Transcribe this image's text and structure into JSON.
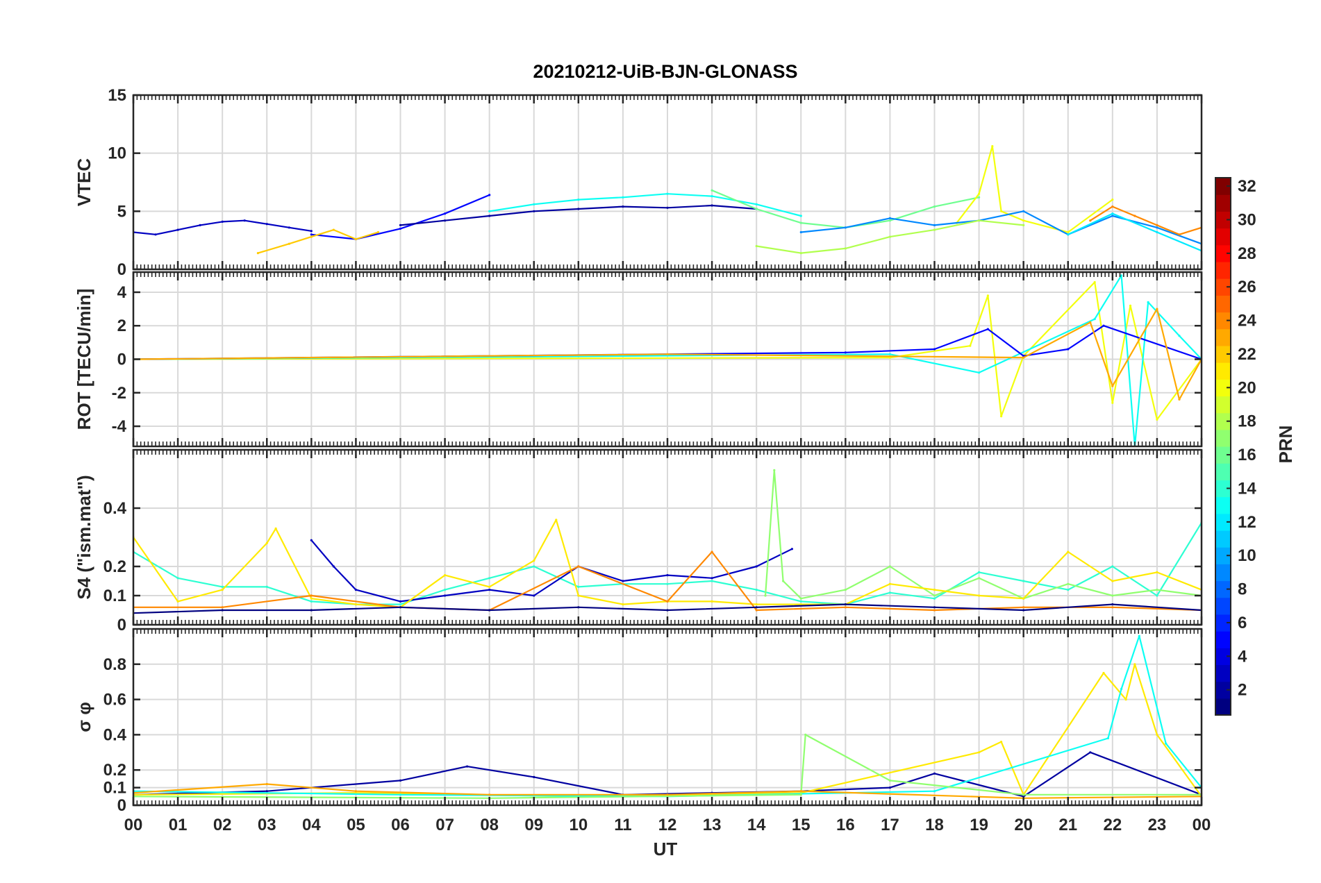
{
  "chart_data": {
    "type": "line",
    "title": "20210212-UiB-BJN-GLONASS",
    "xlabel": "UT",
    "x_ticks": [
      "00",
      "01",
      "02",
      "03",
      "04",
      "05",
      "06",
      "07",
      "08",
      "09",
      "10",
      "11",
      "12",
      "13",
      "14",
      "15",
      "16",
      "17",
      "18",
      "19",
      "20",
      "21",
      "22",
      "23",
      "00"
    ],
    "xlim": [
      0,
      24
    ],
    "grid": true,
    "colorbar": {
      "label": "PRN",
      "colormap": "jet",
      "range": [
        1,
        32
      ],
      "ticks": [
        "2",
        "4",
        "6",
        "8",
        "10",
        "12",
        "14",
        "16",
        "18",
        "20",
        "22",
        "24",
        "26",
        "28",
        "30",
        "32"
      ]
    },
    "panels": [
      {
        "ylabel": "VTEC",
        "ylim": [
          0,
          15
        ],
        "y_ticks": [
          "0",
          "5",
          "10",
          "15"
        ],
        "series": [
          {
            "prn": 3,
            "x": [
              0,
              0.5,
              1,
              1.5,
              2,
              2.5,
              3,
              3.5,
              4
            ],
            "values": [
              3.2,
              3.0,
              3.4,
              3.8,
              4.1,
              4.2,
              3.9,
              3.6,
              3.3
            ]
          },
          {
            "prn": 5,
            "x": [
              4,
              5,
              6,
              7,
              8
            ],
            "values": [
              3.0,
              2.6,
              3.5,
              4.8,
              6.4
            ]
          },
          {
            "prn": 2,
            "x": [
              6,
              7,
              8,
              9,
              10,
              11,
              12,
              13,
              14
            ],
            "values": [
              3.8,
              4.2,
              4.6,
              5.0,
              5.2,
              5.4,
              5.3,
              5.5,
              5.2
            ]
          },
          {
            "prn": 13,
            "x": [
              8,
              9,
              10,
              11,
              12,
              13,
              14,
              15
            ],
            "values": [
              5.0,
              5.6,
              6.0,
              6.2,
              6.5,
              6.3,
              5.6,
              4.6
            ]
          },
          {
            "prn": 16,
            "x": [
              13,
              14,
              15,
              16,
              17,
              18,
              19
            ],
            "values": [
              6.8,
              5.2,
              4.0,
              3.6,
              4.2,
              5.4,
              6.2
            ]
          },
          {
            "prn": 20,
            "x": [
              18.5,
              19,
              19.3,
              19.5,
              20,
              21,
              22
            ],
            "values": [
              4.0,
              6.5,
              10.6,
              5.0,
              4.2,
              3.2,
              6.0
            ]
          },
          {
            "prn": 9,
            "x": [
              15,
              16,
              17,
              18,
              19,
              20,
              21,
              22,
              23,
              24
            ],
            "values": [
              3.2,
              3.6,
              4.4,
              3.8,
              4.2,
              5.0,
              3.0,
              4.6,
              3.6,
              2.2
            ]
          },
          {
            "prn": 22,
            "x": [
              2.8,
              3.5,
              4,
              4.5,
              5,
              5.5
            ],
            "values": [
              1.4,
              2.2,
              2.8,
              3.4,
              2.6,
              3.2
            ]
          },
          {
            "prn": 18,
            "x": [
              14,
              15,
              16,
              17,
              18,
              19,
              20
            ],
            "values": [
              2.0,
              1.4,
              1.8,
              2.8,
              3.4,
              4.2,
              3.8
            ]
          },
          {
            "prn": 12,
            "x": [
              21,
              22,
              23,
              24
            ],
            "values": [
              3.0,
              4.8,
              3.2,
              1.6
            ]
          },
          {
            "prn": 24,
            "x": [
              21.5,
              22,
              22.5,
              23,
              23.5,
              24
            ],
            "values": [
              4.2,
              5.4,
              4.6,
              3.8,
              3.0,
              3.6
            ]
          }
        ]
      },
      {
        "ylabel": "ROT [TECU/min]",
        "ylim": [
          -5.2,
          5.2
        ],
        "y_ticks": [
          "-4",
          "-2",
          "0",
          "2",
          "4"
        ],
        "series": [
          {
            "prn": 20,
            "x": [
              0,
              17,
              18.8,
              19.2,
              19.5,
              20,
              21.6,
              22,
              22.4,
              23,
              24
            ],
            "values": [
              0,
              0.1,
              0.8,
              3.8,
              -3.4,
              0.2,
              4.6,
              -2.6,
              3.2,
              -3.6,
              0
            ]
          },
          {
            "prn": 13,
            "x": [
              0,
              17,
              19,
              21.6,
              22.2,
              22.5,
              22.8,
              23.5,
              24
            ],
            "values": [
              0,
              0.3,
              -0.8,
              2.4,
              5.0,
              -5.2,
              3.4,
              1.4,
              0
            ]
          },
          {
            "prn": 5,
            "x": [
              0,
              16,
              18,
              19.2,
              20,
              21,
              21.8,
              24
            ],
            "values": [
              0,
              0.4,
              0.6,
              1.8,
              0.2,
              0.6,
              2.0,
              0
            ]
          },
          {
            "prn": 23,
            "x": [
              0,
              12,
              20,
              21.5,
              22,
              23,
              23.5,
              24
            ],
            "values": [
              0,
              0.3,
              0.1,
              2.2,
              -1.6,
              3.0,
              -2.4,
              0
            ]
          }
        ]
      },
      {
        "ylabel": "S4 (\"ism.mat\")",
        "ylim": [
          0,
          0.6
        ],
        "y_ticks": [
          "0",
          "0.1",
          "0.2",
          "0.4"
        ],
        "series": [
          {
            "prn": 14,
            "x": [
              0,
              1,
              2,
              3,
              4,
              5,
              6,
              7,
              8,
              9,
              10,
              11,
              12,
              13,
              14,
              15,
              16,
              17,
              18,
              19,
              20,
              21,
              22,
              23,
              24
            ],
            "values": [
              0.25,
              0.16,
              0.13,
              0.13,
              0.08,
              0.07,
              0.07,
              0.12,
              0.16,
              0.2,
              0.13,
              0.14,
              0.14,
              0.15,
              0.12,
              0.08,
              0.07,
              0.11,
              0.09,
              0.18,
              0.15,
              0.12,
              0.2,
              0.1,
              0.35
            ]
          },
          {
            "prn": 3,
            "x": [
              4,
              4.5,
              5,
              6,
              7,
              8,
              9,
              10,
              11,
              12,
              13,
              14,
              14.8
            ],
            "values": [
              0.29,
              0.2,
              0.12,
              0.08,
              0.1,
              0.12,
              0.1,
              0.2,
              0.15,
              0.17,
              0.16,
              0.2,
              0.26
            ]
          },
          {
            "prn": 17,
            "x": [
              14.2,
              14.4,
              14.6,
              15,
              16,
              17,
              18,
              19,
              20,
              21,
              22,
              23,
              24
            ],
            "values": [
              0.1,
              0.53,
              0.15,
              0.09,
              0.12,
              0.2,
              0.1,
              0.16,
              0.09,
              0.14,
              0.1,
              0.12,
              0.1
            ]
          },
          {
            "prn": 21,
            "x": [
              0,
              1,
              2,
              3,
              3.2,
              4,
              5,
              6,
              7,
              8,
              9,
              9.5,
              10,
              11,
              12,
              13,
              14,
              15,
              16,
              17,
              18,
              19,
              20,
              21,
              22,
              23,
              24
            ],
            "values": [
              0.3,
              0.08,
              0.12,
              0.28,
              0.33,
              0.09,
              0.07,
              0.06,
              0.17,
              0.13,
              0.22,
              0.36,
              0.1,
              0.07,
              0.08,
              0.08,
              0.07,
              0.07,
              0.07,
              0.14,
              0.12,
              0.1,
              0.09,
              0.25,
              0.15,
              0.18,
              0.12
            ]
          },
          {
            "prn": 24,
            "x": [
              0,
              2,
              4,
              6,
              8,
              10,
              12,
              13,
              14,
              16,
              18,
              20,
              22,
              24
            ],
            "values": [
              0.06,
              0.06,
              0.1,
              0.06,
              0.05,
              0.2,
              0.08,
              0.25,
              0.05,
              0.06,
              0.05,
              0.06,
              0.06,
              0.05
            ]
          },
          {
            "prn": 1,
            "x": [
              0,
              2,
              4,
              6,
              8,
              10,
              12,
              14,
              16,
              18,
              20,
              22,
              24
            ],
            "values": [
              0.04,
              0.05,
              0.05,
              0.06,
              0.05,
              0.06,
              0.05,
              0.06,
              0.07,
              0.06,
              0.05,
              0.07,
              0.05
            ]
          }
        ]
      },
      {
        "ylabel": "σ φ",
        "ylim": [
          0,
          1
        ],
        "y_ticks": [
          "0",
          "0.1",
          "0.2",
          "0.4",
          "0.6",
          "0.8"
        ],
        "series": [
          {
            "prn": 2,
            "x": [
              0,
              3,
              6,
              7.5,
              9,
              11,
              13,
              15,
              17,
              18,
              20,
              21.5,
              24
            ],
            "values": [
              0.06,
              0.08,
              0.14,
              0.22,
              0.16,
              0.06,
              0.07,
              0.08,
              0.1,
              0.18,
              0.05,
              0.3,
              0.06
            ]
          },
          {
            "prn": 21,
            "x": [
              0,
              5,
              10,
              15,
              19,
              19.5,
              20,
              21.8,
              22.3,
              22.5,
              23,
              24
            ],
            "values": [
              0.06,
              0.07,
              0.05,
              0.07,
              0.3,
              0.36,
              0.06,
              0.75,
              0.6,
              0.8,
              0.4,
              0.05
            ]
          },
          {
            "prn": 13,
            "x": [
              0,
              6,
              12,
              18,
              21.9,
              22.2,
              22.6,
              23.2,
              24
            ],
            "values": [
              0.08,
              0.06,
              0.05,
              0.08,
              0.38,
              0.66,
              0.96,
              0.35,
              0.1
            ]
          },
          {
            "prn": 17,
            "x": [
              0,
              8,
              15,
              15.1,
              17,
              20,
              24
            ],
            "values": [
              0.05,
              0.04,
              0.06,
              0.4,
              0.14,
              0.06,
              0.06
            ]
          },
          {
            "prn": 23,
            "x": [
              0,
              3,
              5,
              8,
              12,
              15,
              20,
              24
            ],
            "values": [
              0.07,
              0.12,
              0.08,
              0.06,
              0.06,
              0.08,
              0.04,
              0.05
            ]
          }
        ]
      }
    ]
  }
}
